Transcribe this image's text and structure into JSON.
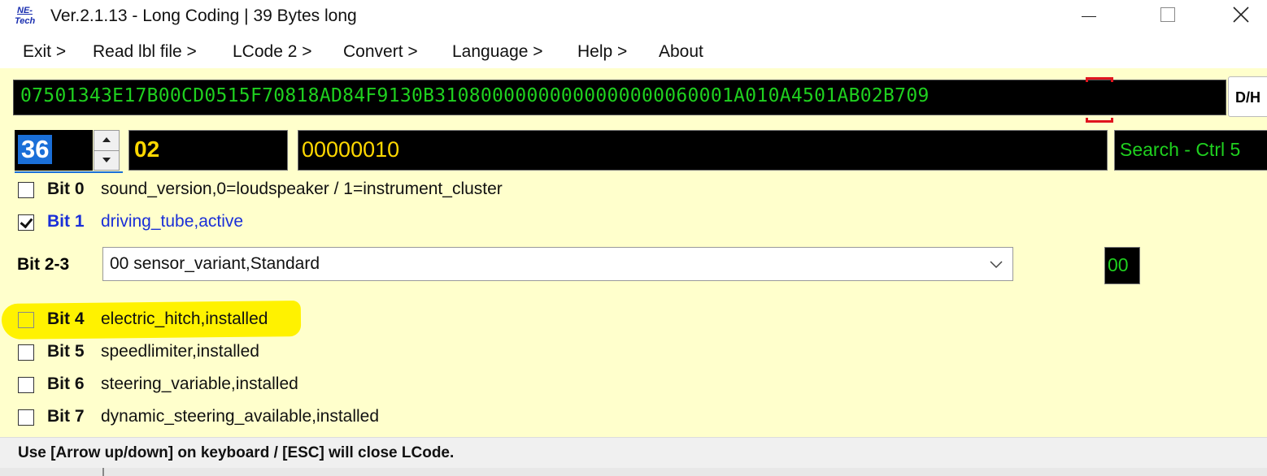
{
  "window": {
    "logo_line1": "NE-",
    "logo_line2": "Tech",
    "title": "Ver.2.1.13 - Long Coding | 39 Bytes long"
  },
  "menu": [
    "Exit >",
    "Read lbl file >",
    "LCode 2 >",
    "Convert >",
    "Language >",
    "Help >",
    "About"
  ],
  "coding": {
    "hex_string": "07501343E17B00CD0515F70818AD84F9130B31080000000000000000060001A010A4501AB02B709",
    "dh_button": "D/H"
  },
  "byte_editor": {
    "byte_index": "36",
    "hex_value": "02",
    "binary_value": "00000010",
    "search_label": "Search - Ctrl 5"
  },
  "bits": [
    {
      "label": "Bit 0",
      "desc": "sound_version,0=loudspeaker / 1=instrument_cluster",
      "checked": false
    },
    {
      "label": "Bit 1",
      "desc": "driving_tube,active",
      "checked": true
    },
    {
      "label": "Bit 4",
      "desc": "electric_hitch,installed",
      "checked": false
    },
    {
      "label": "Bit 5",
      "desc": "speedlimiter,installed",
      "checked": false
    },
    {
      "label": "Bit 6",
      "desc": "steering_variable,installed",
      "checked": false
    },
    {
      "label": "Bit 7",
      "desc": "dynamic_steering_available,installed",
      "checked": false
    }
  ],
  "bit_group": {
    "label": "Bit 2-3",
    "selected": "00 sensor_variant,Standard",
    "value": "00"
  },
  "status": {
    "text": "Use [Arrow up/down] on keyboard / [ESC] will close LCode."
  },
  "colors": {
    "background": "#ffffcc",
    "hex_green": "#1fd01f",
    "value_yellow": "#ffd800",
    "highlight": "#fff200",
    "active_blue": "#1a2fd8"
  }
}
